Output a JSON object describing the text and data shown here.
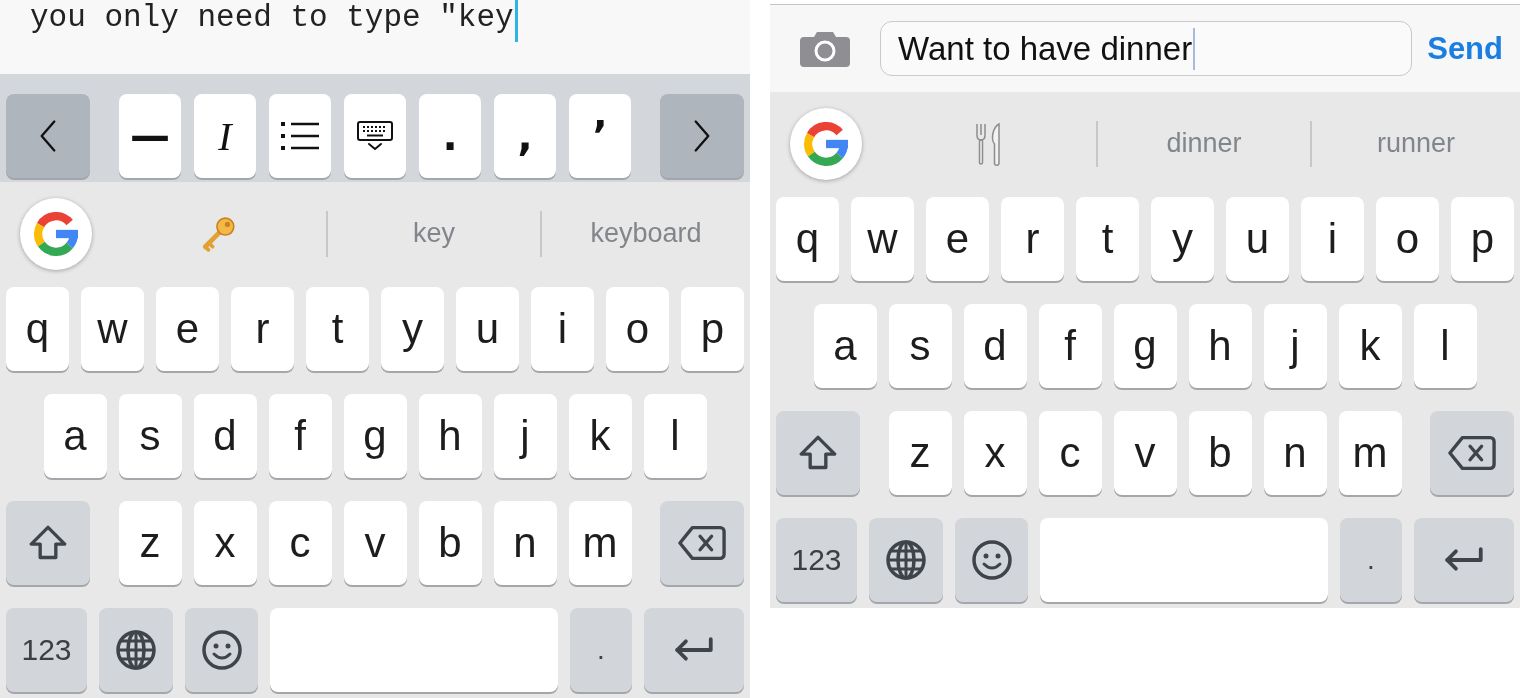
{
  "panels": [
    {
      "kind": "notes",
      "document": {
        "text": "you only need to type \"key"
      },
      "toolbar": {
        "keys": [
          {
            "kind": "back"
          },
          {
            "kind": "char",
            "label": "—"
          },
          {
            "kind": "italic",
            "label": "I"
          },
          {
            "kind": "list"
          },
          {
            "kind": "hide-keyboard"
          },
          {
            "kind": "char",
            "label": "."
          },
          {
            "kind": "char",
            "label": ","
          },
          {
            "kind": "char",
            "label": "’"
          },
          {
            "kind": "forward"
          }
        ]
      },
      "suggestions": [
        {
          "kind": "key-emoji"
        },
        {
          "kind": "word",
          "label": "key"
        },
        {
          "kind": "word",
          "label": "keyboard"
        }
      ],
      "keyboard": {
        "rows": [
          {
            "keys": [
              {
                "kind": "letter",
                "label": "q"
              },
              {
                "kind": "letter",
                "label": "w"
              },
              {
                "kind": "letter",
                "label": "e"
              },
              {
                "kind": "letter",
                "label": "r"
              },
              {
                "kind": "letter",
                "label": "t"
              },
              {
                "kind": "letter",
                "label": "y"
              },
              {
                "kind": "letter",
                "label": "u"
              },
              {
                "kind": "letter",
                "label": "i"
              },
              {
                "kind": "letter",
                "label": "o"
              },
              {
                "kind": "letter",
                "label": "p"
              }
            ]
          },
          {
            "keys": [
              {
                "kind": "letter",
                "label": "a"
              },
              {
                "kind": "letter",
                "label": "s"
              },
              {
                "kind": "letter",
                "label": "d"
              },
              {
                "kind": "letter",
                "label": "f"
              },
              {
                "kind": "letter",
                "label": "g"
              },
              {
                "kind": "letter",
                "label": "h"
              },
              {
                "kind": "letter",
                "label": "j"
              },
              {
                "kind": "letter",
                "label": "k"
              },
              {
                "kind": "letter",
                "label": "l"
              }
            ]
          },
          {
            "keys": [
              {
                "kind": "shift"
              },
              {
                "kind": "letter",
                "label": "z"
              },
              {
                "kind": "letter",
                "label": "x"
              },
              {
                "kind": "letter",
                "label": "c"
              },
              {
                "kind": "letter",
                "label": "v"
              },
              {
                "kind": "letter",
                "label": "b"
              },
              {
                "kind": "letter",
                "label": "n"
              },
              {
                "kind": "letter",
                "label": "m"
              },
              {
                "kind": "backspace"
              }
            ]
          },
          {
            "keys": [
              {
                "kind": "symbols",
                "label": "123"
              },
              {
                "kind": "globe"
              },
              {
                "kind": "emoji"
              },
              {
                "kind": "space"
              },
              {
                "kind": "char",
                "label": "."
              },
              {
                "kind": "return"
              }
            ]
          }
        ]
      }
    },
    {
      "kind": "messages",
      "compose": {
        "value": "Want to have dinner",
        "send": "Send"
      },
      "suggestions": [
        {
          "kind": "cutlery-emoji"
        },
        {
          "kind": "word",
          "label": "dinner"
        },
        {
          "kind": "word",
          "label": "runner"
        }
      ],
      "keyboard": {
        "rows": [
          {
            "keys": [
              {
                "kind": "letter",
                "label": "q"
              },
              {
                "kind": "letter",
                "label": "w"
              },
              {
                "kind": "letter",
                "label": "e"
              },
              {
                "kind": "letter",
                "label": "r"
              },
              {
                "kind": "letter",
                "label": "t"
              },
              {
                "kind": "letter",
                "label": "y"
              },
              {
                "kind": "letter",
                "label": "u"
              },
              {
                "kind": "letter",
                "label": "i"
              },
              {
                "kind": "letter",
                "label": "o"
              },
              {
                "kind": "letter",
                "label": "p"
              }
            ]
          },
          {
            "keys": [
              {
                "kind": "letter",
                "label": "a"
              },
              {
                "kind": "letter",
                "label": "s"
              },
              {
                "kind": "letter",
                "label": "d"
              },
              {
                "kind": "letter",
                "label": "f"
              },
              {
                "kind": "letter",
                "label": "g"
              },
              {
                "kind": "letter",
                "label": "h"
              },
              {
                "kind": "letter",
                "label": "j"
              },
              {
                "kind": "letter",
                "label": "k"
              },
              {
                "kind": "letter",
                "label": "l"
              }
            ]
          },
          {
            "keys": [
              {
                "kind": "shift"
              },
              {
                "kind": "letter",
                "label": "z"
              },
              {
                "kind": "letter",
                "label": "x"
              },
              {
                "kind": "letter",
                "label": "c"
              },
              {
                "kind": "letter",
                "label": "v"
              },
              {
                "kind": "letter",
                "label": "b"
              },
              {
                "kind": "letter",
                "label": "n"
              },
              {
                "kind": "letter",
                "label": "m"
              },
              {
                "kind": "backspace"
              }
            ]
          },
          {
            "keys": [
              {
                "kind": "symbols",
                "label": "123"
              },
              {
                "kind": "globe"
              },
              {
                "kind": "emoji"
              },
              {
                "kind": "space"
              },
              {
                "kind": "char",
                "label": "."
              },
              {
                "kind": "return"
              }
            ]
          }
        ]
      }
    }
  ]
}
